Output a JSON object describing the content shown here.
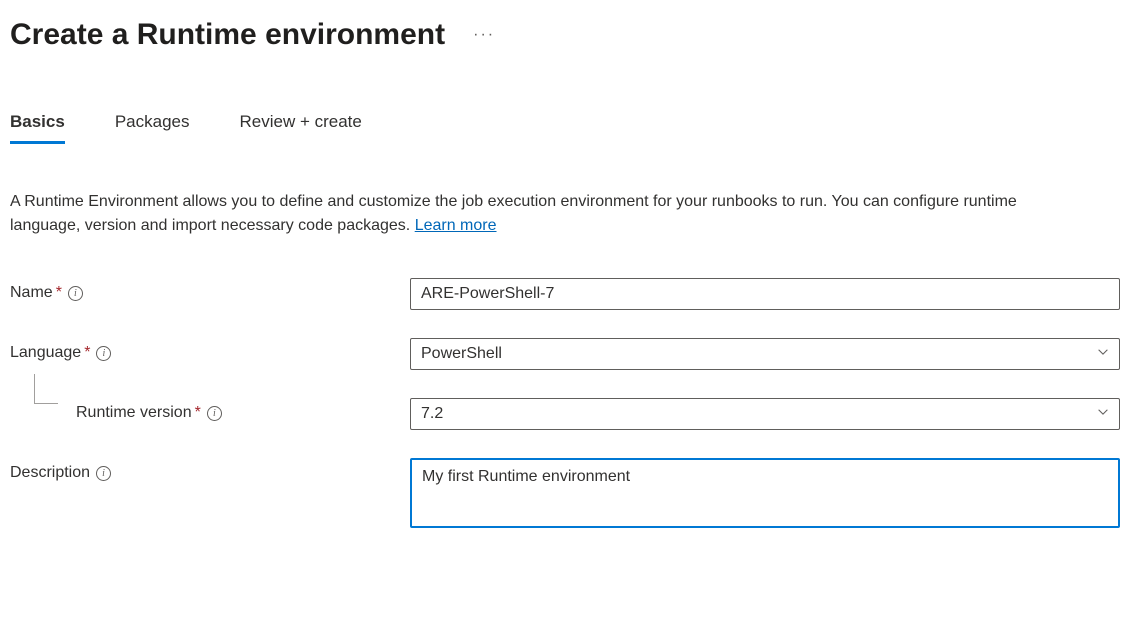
{
  "header": {
    "title": "Create a Runtime environment"
  },
  "tabs": [
    {
      "label": "Basics",
      "active": true
    },
    {
      "label": "Packages",
      "active": false
    },
    {
      "label": "Review + create",
      "active": false
    }
  ],
  "intro": {
    "text": "A Runtime Environment allows you to define and customize the job execution environment for your runbooks to run. You can configure runtime language, version and import necessary code packages. ",
    "link_label": "Learn more"
  },
  "form": {
    "name": {
      "label": "Name",
      "required": true,
      "value": "ARE-PowerShell-7"
    },
    "language": {
      "label": "Language",
      "required": true,
      "value": "PowerShell"
    },
    "runtime_version": {
      "label": "Runtime version",
      "required": true,
      "value": "7.2"
    },
    "description": {
      "label": "Description",
      "required": false,
      "value": "My first Runtime environment"
    }
  }
}
